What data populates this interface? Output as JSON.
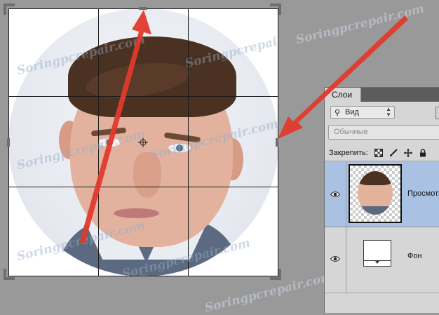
{
  "watermark": {
    "text": "Soringpcrepair.com"
  },
  "canvas": {
    "image_description": "",
    "crosshair_icon": "crosshair-icon"
  },
  "layers_panel": {
    "tab_label": "Слои",
    "filter": {
      "placeholder": "Вид",
      "icon": "search-icon"
    },
    "blend_mode": "Обычные",
    "lock_label": "Закрепить:",
    "lock_icons": [
      "checker-lock-icon",
      "brush-lock-icon",
      "move-lock-icon",
      "padlock-icon"
    ],
    "layers": [
      {
        "name": "Просмотр",
        "visible": true,
        "selected": true,
        "icon": "eye-icon"
      },
      {
        "name": "Фон",
        "visible": true,
        "selected": false,
        "icon": "eye-icon"
      }
    ]
  },
  "annotations": {
    "arrow_color": "#e03a2c"
  }
}
